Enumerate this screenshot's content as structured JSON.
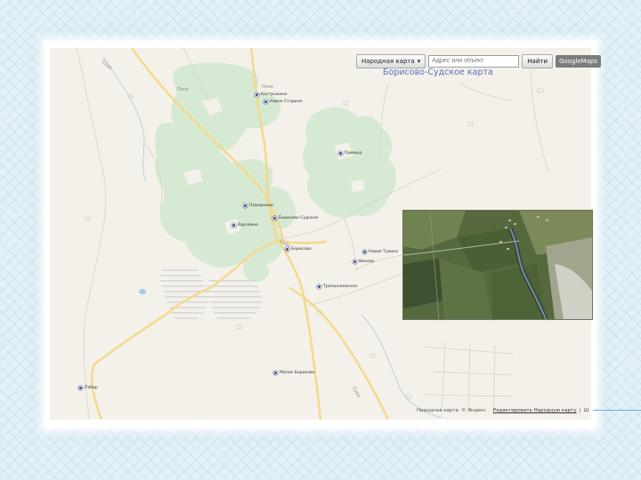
{
  "toolbar": {
    "map_type": "Народная карта",
    "map_type_arrow": "▾",
    "search_placeholder": "Адрес или объект",
    "find_button": "Найти",
    "google_maps": "GoogleMaps"
  },
  "map_title": {
    "link1": "Борисово",
    "separator": "-",
    "link2": "Судское карта"
  },
  "places": [
    {
      "name": "Кастрыкино"
    },
    {
      "name": "Новое Старино"
    },
    {
      "name": "Примыр"
    },
    {
      "name": "Поводники"
    },
    {
      "name": "Борисово-Судское"
    },
    {
      "name": "Аарчевно"
    },
    {
      "name": "Борисово"
    },
    {
      "name": "Новая Тукино"
    },
    {
      "name": "Винево"
    },
    {
      "name": "Тропшнаевская"
    },
    {
      "name": "Малое Борисово"
    },
    {
      "name": "Пябар"
    }
  ],
  "road_labels": {
    "river_north": "Суда",
    "road_nw": "Пячо",
    "road_ne": "Пячо",
    "road_center": "Суда",
    "road_south": "Суда"
  },
  "footer": {
    "text": "Народная карта",
    "copyright": "© Яндекс",
    "separator": "·",
    "edit_link": "Редактировать Народную карту",
    "pipe": "|",
    "more": "Ш"
  },
  "colors": {
    "background": "#e3f1f7",
    "map_base": "#f3f1e9",
    "forest": "#d6e9d2",
    "roads": "#f5d88a",
    "water": "#aac8e8",
    "title_link": "#5a6fc4"
  }
}
